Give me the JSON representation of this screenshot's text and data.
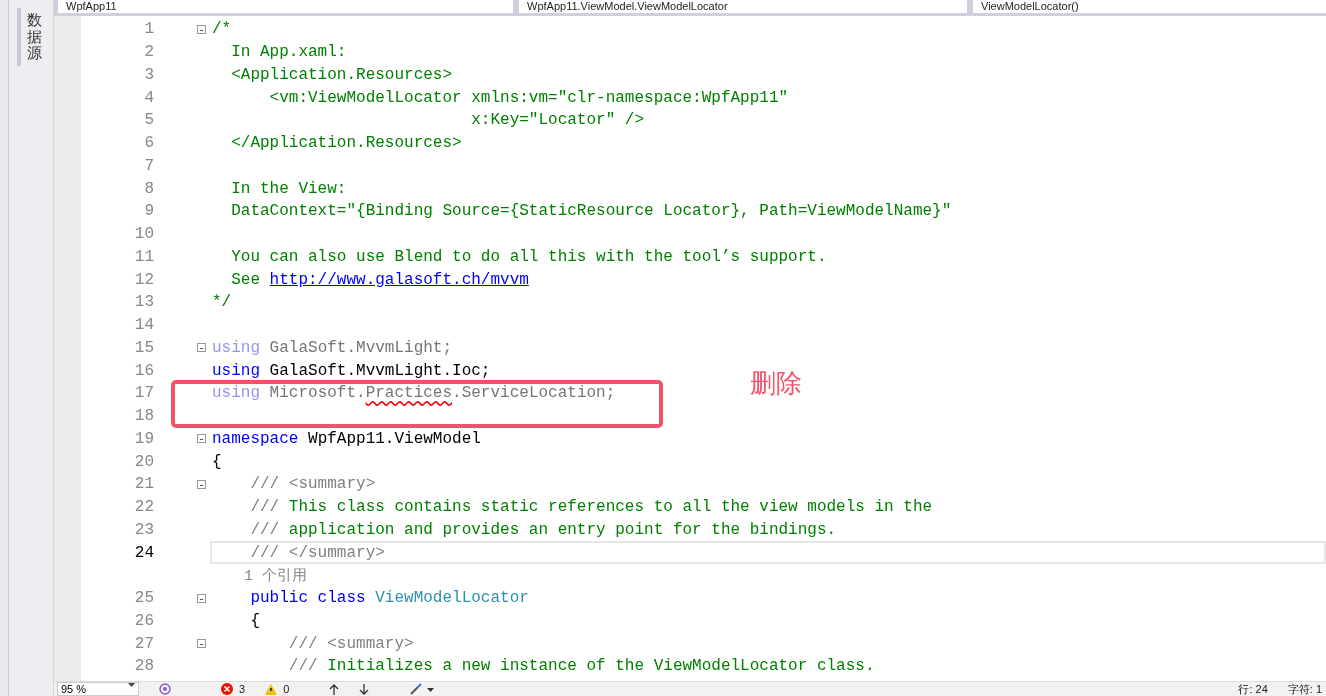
{
  "side_tab": {
    "label": "数据源",
    "selected": true
  },
  "nav_bar": [
    "WpfApp11",
    "WpfApp11.ViewModel.ViewModelLocator",
    "ViewModelLocator()"
  ],
  "editor": {
    "lines": [
      {
        "kind": "code",
        "number": "1",
        "fold": true,
        "current": false,
        "segments": [
          {
            "kind": "comment",
            "text": "/*"
          }
        ]
      },
      {
        "kind": "code",
        "number": "2",
        "fold": false,
        "current": false,
        "segments": [
          {
            "kind": "comment",
            "text": "  In App.xaml:"
          }
        ]
      },
      {
        "kind": "code",
        "number": "3",
        "fold": false,
        "current": false,
        "segments": [
          {
            "kind": "comment",
            "text": "  <Application.Resources>"
          }
        ]
      },
      {
        "kind": "code",
        "number": "4",
        "fold": false,
        "current": false,
        "segments": [
          {
            "kind": "comment",
            "text": "      <vm:ViewModelLocator xmlns:vm=\"clr-namespace:WpfApp11\""
          }
        ]
      },
      {
        "kind": "code",
        "number": "5",
        "fold": false,
        "current": false,
        "segments": [
          {
            "kind": "comment",
            "text": "                           x:Key=\"Locator\" />"
          }
        ]
      },
      {
        "kind": "code",
        "number": "6",
        "fold": false,
        "current": false,
        "segments": [
          {
            "kind": "comment",
            "text": "  </Application.Resources>"
          }
        ]
      },
      {
        "kind": "code",
        "number": "7",
        "fold": false,
        "current": false
      },
      {
        "kind": "code",
        "number": "8",
        "fold": false,
        "current": false,
        "segments": [
          {
            "kind": "comment",
            "text": "  In the View:"
          }
        ]
      },
      {
        "kind": "code",
        "number": "9",
        "fold": false,
        "current": false,
        "segments": [
          {
            "kind": "comment",
            "text": "  DataContext=\"{Binding Source={StaticResource Locator}, Path=ViewModelName}\""
          }
        ]
      },
      {
        "kind": "code",
        "number": "10",
        "fold": false,
        "current": false
      },
      {
        "kind": "code",
        "number": "11",
        "fold": false,
        "current": false,
        "segments": [
          {
            "kind": "comment",
            "text": "  You can also use Blend to do all this with the tool’s support."
          }
        ]
      },
      {
        "kind": "code",
        "number": "12",
        "fold": false,
        "current": false,
        "segments": [
          {
            "kind": "comment",
            "text": "  See "
          },
          {
            "kind": "link",
            "text": "http://www.galasoft.ch/mvvm"
          }
        ]
      },
      {
        "kind": "code",
        "number": "13",
        "fold": false,
        "current": false,
        "segments": [
          {
            "kind": "comment",
            "text": "*/"
          }
        ]
      },
      {
        "kind": "code",
        "number": "14",
        "fold": false,
        "current": false
      },
      {
        "kind": "code",
        "number": "15",
        "fold": true,
        "current": false,
        "segments": [
          {
            "kind": "unused-keyword",
            "text": "using"
          },
          {
            "kind": "unused",
            "text": " GalaSoft.MvvmLight;"
          }
        ]
      },
      {
        "kind": "code",
        "number": "16",
        "fold": false,
        "current": false,
        "segments": [
          {
            "kind": "keyword",
            "text": "using"
          },
          {
            "kind": "plain",
            "text": " GalaSoft.MvvmLight.Ioc;"
          }
        ]
      },
      {
        "kind": "code",
        "number": "17",
        "fold": false,
        "current": false,
        "segments": [
          {
            "kind": "unused-keyword",
            "text": "using"
          },
          {
            "kind": "unused",
            "text": " Microsoft."
          },
          {
            "kind": "unused",
            "text": "Practices",
            "squiggle": true
          },
          {
            "kind": "unused",
            "text": ".ServiceLocation;"
          }
        ]
      },
      {
        "kind": "code",
        "number": "18",
        "fold": false,
        "current": false
      },
      {
        "kind": "code",
        "number": "19",
        "fold": true,
        "current": false,
        "segments": [
          {
            "kind": "keyword",
            "text": "namespace"
          },
          {
            "kind": "plain",
            "text": " WpfApp11.ViewModel"
          }
        ]
      },
      {
        "kind": "code",
        "number": "20",
        "fold": false,
        "current": false,
        "segments": [
          {
            "kind": "plain",
            "text": "{"
          }
        ]
      },
      {
        "kind": "code",
        "number": "21",
        "fold": true,
        "current": false,
        "segments": [
          {
            "kind": "doc",
            "text": "    /// <summary>"
          }
        ]
      },
      {
        "kind": "code",
        "number": "22",
        "fold": false,
        "current": false,
        "segments": [
          {
            "kind": "doc",
            "text": "    /// "
          },
          {
            "kind": "comment",
            "text": "This class contains static references to all the view models in the"
          }
        ]
      },
      {
        "kind": "code",
        "number": "23",
        "fold": false,
        "current": false,
        "segments": [
          {
            "kind": "doc",
            "text": "    /// "
          },
          {
            "kind": "comment",
            "text": "application and provides an entry point for the bindings."
          }
        ]
      },
      {
        "kind": "code",
        "number": "24",
        "fold": false,
        "current": true,
        "segments": [
          {
            "kind": "doc",
            "text": "    /// </summary>"
          }
        ]
      },
      {
        "kind": "codelens",
        "text": "    1 个引用"
      },
      {
        "kind": "code",
        "number": "25",
        "fold": true,
        "current": false,
        "segments": [
          {
            "kind": "keyword",
            "text": "    public"
          },
          {
            "kind": "keyword",
            "text": " class"
          },
          {
            "kind": "type",
            "text": " ViewModelLocator"
          }
        ]
      },
      {
        "kind": "code",
        "number": "26",
        "fold": false,
        "current": false,
        "segments": [
          {
            "kind": "plain",
            "text": "    {"
          }
        ]
      },
      {
        "kind": "code",
        "number": "27",
        "fold": true,
        "current": false,
        "segments": [
          {
            "kind": "doc",
            "text": "        /// <summary>"
          }
        ]
      },
      {
        "kind": "code",
        "number": "28",
        "fold": false,
        "current": false,
        "segments": [
          {
            "kind": "doc",
            "text": "        /// "
          },
          {
            "kind": "comment",
            "text": "Initializes a new instance of the ViewModelLocator class."
          }
        ]
      }
    ]
  },
  "annotation": {
    "text": "删除"
  },
  "status_bar": {
    "zoom": "95 %",
    "errors": "3",
    "warnings": "0",
    "line": "行: 24",
    "column": "字符: 1"
  }
}
